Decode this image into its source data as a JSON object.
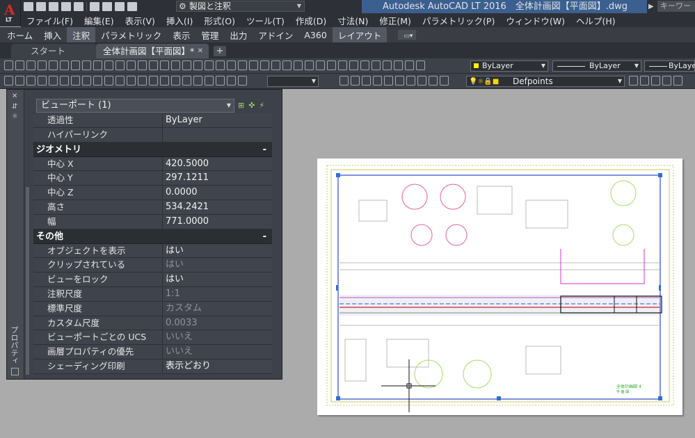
{
  "app": {
    "logo_letter": "A",
    "logo_sub": "LT"
  },
  "titlebar": {
    "workspace": "製図と注釈",
    "title": "Autodesk AutoCAD LT 2016　全体計画図【平面図】.dwg",
    "search_placeholder": "キーワード"
  },
  "menu": [
    "ファイル(F)",
    "編集(E)",
    "表示(V)",
    "挿入(I)",
    "形式(O)",
    "ツール(T)",
    "作成(D)",
    "寸法(N)",
    "修正(M)",
    "パラメトリック(P)",
    "ウィンドウ(W)",
    "ヘルプ(H)"
  ],
  "ribbon_tabs": [
    "ホーム",
    "挿入",
    "注釈",
    "パラメトリック",
    "表示",
    "管理",
    "出力",
    "アドイン",
    "A360",
    "レイアウト"
  ],
  "file_tabs": {
    "start": "スタート",
    "doc": "全体計画図【平面図】*"
  },
  "toolbar": {
    "color": "ByLayer",
    "linetype": "ByLayer",
    "lineweight": "ByLayer",
    "layer": "Defpoints",
    "textstyle": ""
  },
  "properties": {
    "palette_title": "プロパティ",
    "selector": "ビューポート (1)",
    "top_rows": [
      {
        "label": "透過性",
        "value": "ByLayer",
        "dim": false
      },
      {
        "label": "ハイパーリンク",
        "value": "",
        "dim": false
      }
    ],
    "geometry": {
      "title": "ジオメトリ",
      "rows": [
        {
          "label": "中心 X",
          "value": "420.5000",
          "dim": false
        },
        {
          "label": "中心 Y",
          "value": "297.1211",
          "dim": false
        },
        {
          "label": "中心 Z",
          "value": "0.0000",
          "dim": false
        },
        {
          "label": "高さ",
          "value": "534.2421",
          "dim": false
        },
        {
          "label": "幅",
          "value": "771.0000",
          "dim": false
        }
      ]
    },
    "misc": {
      "title": "その他",
      "rows": [
        {
          "label": "オブジェクトを表示",
          "value": "はい",
          "dim": false
        },
        {
          "label": "クリップされている",
          "value": "はい",
          "dim": true
        },
        {
          "label": "ビューをロック",
          "value": "はい",
          "dim": false
        },
        {
          "label": "注釈尺度",
          "value": "1:1",
          "dim": true
        },
        {
          "label": "標準尺度",
          "value": "カスタム",
          "dim": true
        },
        {
          "label": "カスタム尺度",
          "value": "0.0033",
          "dim": true
        },
        {
          "label": "ビューポートごとの UCS",
          "value": "いいえ",
          "dim": true
        },
        {
          "label": "画層プロパティの優先",
          "value": "いいえ",
          "dim": true
        },
        {
          "label": "シェーディング印刷",
          "value": "表示どおり",
          "dim": false
        }
      ]
    }
  },
  "drawing": {
    "title_block": "全体計画図 4",
    "title_block_sub": "平 面 図"
  }
}
